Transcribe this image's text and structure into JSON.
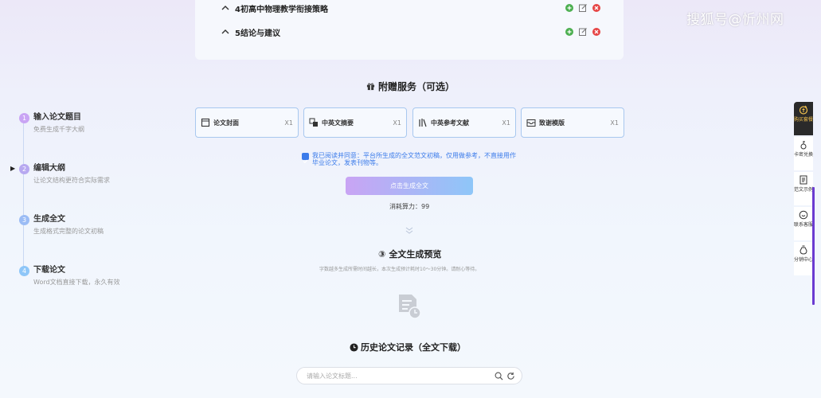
{
  "outline": {
    "items": [
      {
        "label": "4初高中物理教学衔接策略"
      },
      {
        "label": "5结论与建议"
      }
    ]
  },
  "gift_section": {
    "title": "附赠服务（可选）"
  },
  "steps": [
    {
      "num": "1",
      "title": "输入论文题目",
      "desc": "免费生成千字大纲",
      "color": "#c9a4f4"
    },
    {
      "num": "2",
      "title": "编辑大纲",
      "desc": "让论文结构更符合实际需求",
      "color": "#b7a8f0"
    },
    {
      "num": "3",
      "title": "生成全文",
      "desc": "生成格式完整的论文初稿",
      "color": "#9bbcf5"
    },
    {
      "num": "4",
      "title": "下载论文",
      "desc": "Word文档直接下载，永久有效",
      "color": "#8ec6f8"
    }
  ],
  "services": [
    {
      "name": "论文封面",
      "qty": "X1",
      "icon": "cover-icon"
    },
    {
      "name": "中英文摘要",
      "qty": "X1",
      "icon": "abstract-icon"
    },
    {
      "name": "中英参考文献",
      "qty": "X1",
      "icon": "books-icon"
    },
    {
      "name": "致谢模版",
      "qty": "X1",
      "icon": "envelope-icon"
    }
  ],
  "agreement": {
    "text": "我已阅读并同意：平台所生成的全文范文初稿，仅用做参考，不直接用作毕业论文，发表刊物等。",
    "checked": true
  },
  "generate_button": "点击生成全文",
  "cost": "消耗算力：99",
  "preview": {
    "num": "③",
    "title": "全文生成预览",
    "note": "字数越多生成所需时间越长，本次生成预计耗时10～30分钟。请耐心等待。"
  },
  "history": {
    "title": "历史论文记录（全文下载）",
    "search_placeholder": "请输入论文标题..."
  },
  "watermark": "搜狐号@忻州网",
  "sidebar": [
    {
      "label": "购买套餐",
      "icon": "coin-icon",
      "active": true
    },
    {
      "label": "卡密兑换",
      "icon": "key-icon"
    },
    {
      "label": "范文示例",
      "icon": "document-icon"
    },
    {
      "label": "联系客服",
      "icon": "chat-icon"
    },
    {
      "label": "分销中心",
      "icon": "moneybag-icon"
    }
  ],
  "colors": {
    "accent": "#3b7bea",
    "danger": "#e64545",
    "success": "#4caf50",
    "active_nav": "#2a2a2a"
  }
}
